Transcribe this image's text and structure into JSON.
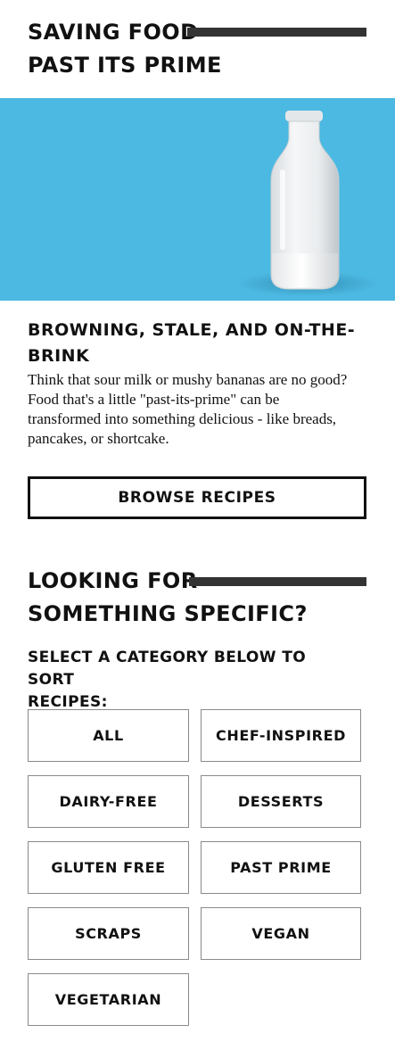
{
  "section1": {
    "title_line1": "SAVING FOOD",
    "title_line2": "PAST ITS PRIME"
  },
  "hero": {
    "image": "milk-bottle",
    "background": "#4cb9e2"
  },
  "article": {
    "subtitle_line1": "BROWNING, STALE, AND ON-THE-",
    "subtitle_line2": "BRINK",
    "description_lines": [
      "Think that sour milk or mushy bananas are no good?",
      "Food that's a little \"past-its-prime\" can be",
      "transformed into something delicious - like breads,",
      "pancakes, or shortcake."
    ],
    "browse_label": "BROWSE RECIPES"
  },
  "section2": {
    "title_line1": "LOOKING FOR",
    "title_line2": "SOMETHING SPECIFIC?",
    "select_line1": "SELECT A CATEGORY BELOW TO SORT",
    "select_line2": "RECIPES:"
  },
  "categories": [
    "ALL",
    "CHEF-INSPIRED",
    "DAIRY-FREE",
    "DESSERTS",
    "GLUTEN FREE",
    "PAST PRIME",
    "SCRAPS",
    "VEGAN",
    "VEGETARIAN"
  ],
  "colors": {
    "rule": "#333333",
    "text": "#111111"
  }
}
